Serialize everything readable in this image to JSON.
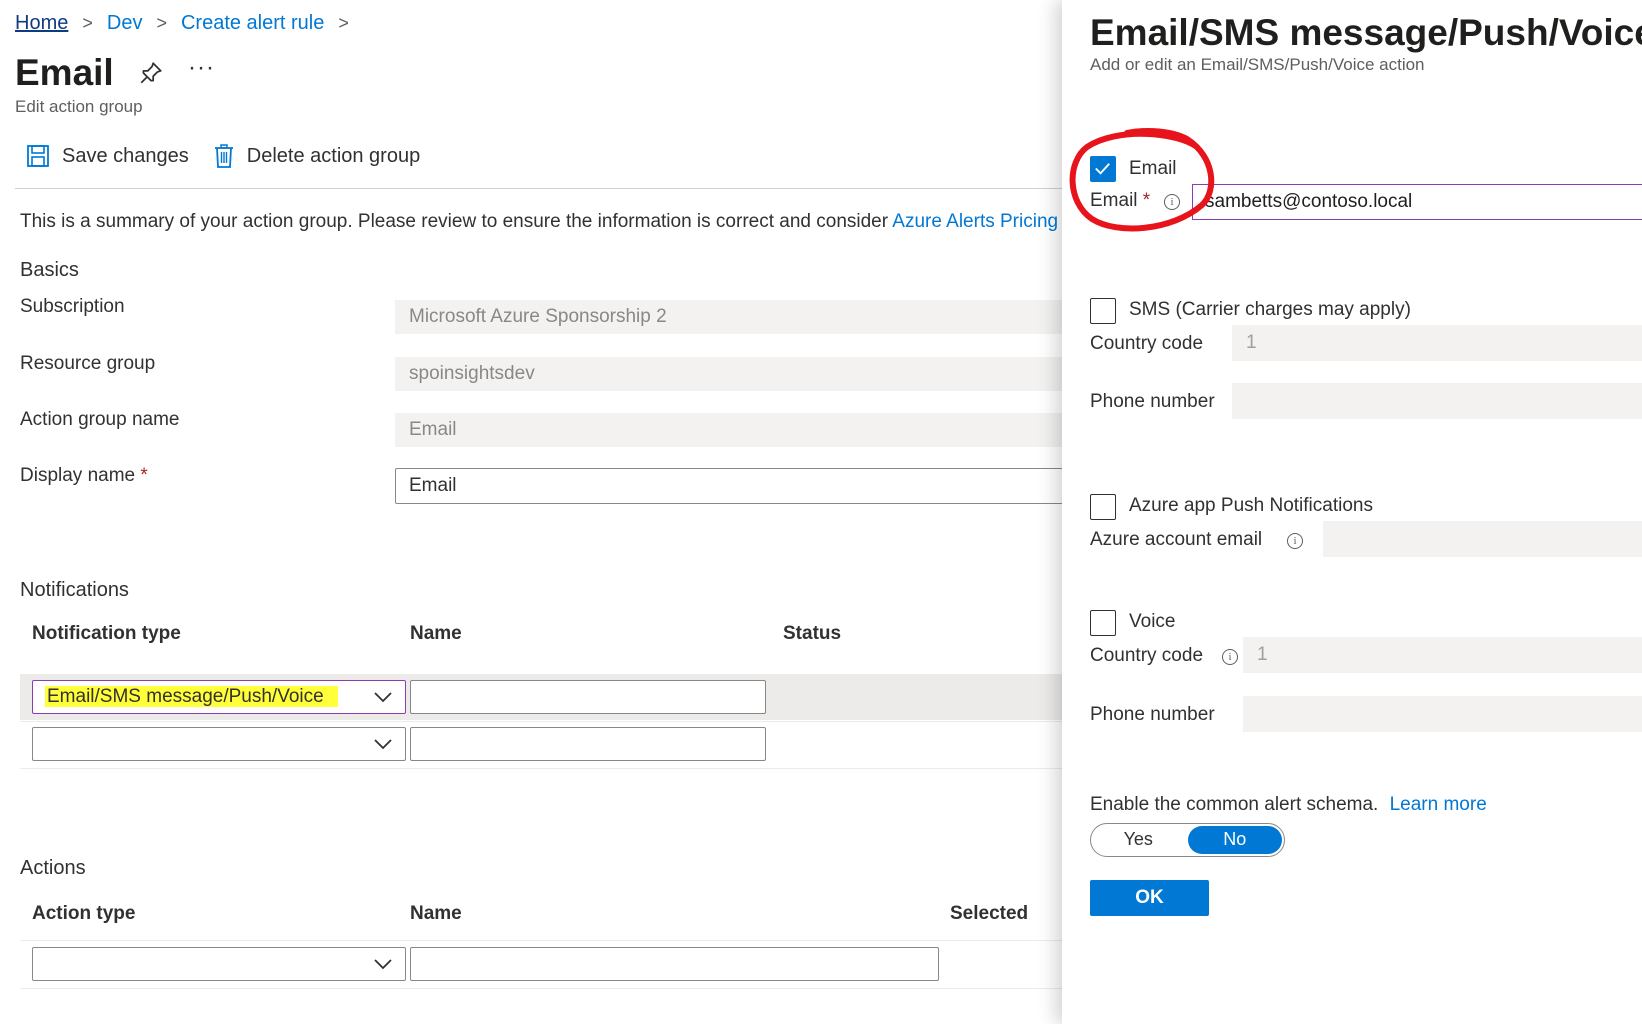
{
  "breadcrumb": {
    "home": "Home",
    "dev": "Dev",
    "create": "Create alert rule"
  },
  "page": {
    "title": "Email",
    "more": "···",
    "subtitle": "Edit action group"
  },
  "toolbar": {
    "save": "Save changes",
    "delete": "Delete action group"
  },
  "summary": {
    "text": "This is a summary of your action group. Please review to ensure the information is correct and consider ",
    "link": "Azure Alerts Pricing"
  },
  "basics": {
    "heading": "Basics",
    "subscription_label": "Subscription",
    "subscription_value": "Microsoft Azure Sponsorship 2",
    "rg_label": "Resource group",
    "rg_value": "spoinsightsdev",
    "agn_label": "Action group name",
    "agn_value": "Email",
    "dn_label": "Display name",
    "dn_value": "Email",
    "required": "*"
  },
  "notifications": {
    "heading": "Notifications",
    "col_type": "Notification type",
    "col_name": "Name",
    "col_status": "Status",
    "row1_type": "Email/SMS message/Push/Voice"
  },
  "actions": {
    "heading": "Actions",
    "col_type": "Action type",
    "col_name": "Name",
    "col_selected": "Selected"
  },
  "panel": {
    "title": "Email/SMS message/Push/Voice",
    "subtitle": "Add or edit an Email/SMS/Push/Voice action",
    "email_check": "Email",
    "email_label": "Email",
    "required": "*",
    "email_value": "sambetts@contoso.local",
    "sms_check": "SMS (Carrier charges may apply)",
    "country_code_label": "Country code",
    "country_code_value": "1",
    "phone_label": "Phone number",
    "push_check": "Azure app Push Notifications",
    "azure_email_label": "Azure account email",
    "voice_check": "Voice",
    "voice_country_label": "Country code",
    "voice_country_value": "1",
    "voice_phone_label": "Phone number",
    "schema_text": "Enable the common alert schema.",
    "learn_more": "Learn more",
    "yes": "Yes",
    "no": "No",
    "ok": "OK"
  },
  "colors": {
    "accent": "#0078d4",
    "highlight": "#ffff3a",
    "annotation": "#e8141c"
  }
}
